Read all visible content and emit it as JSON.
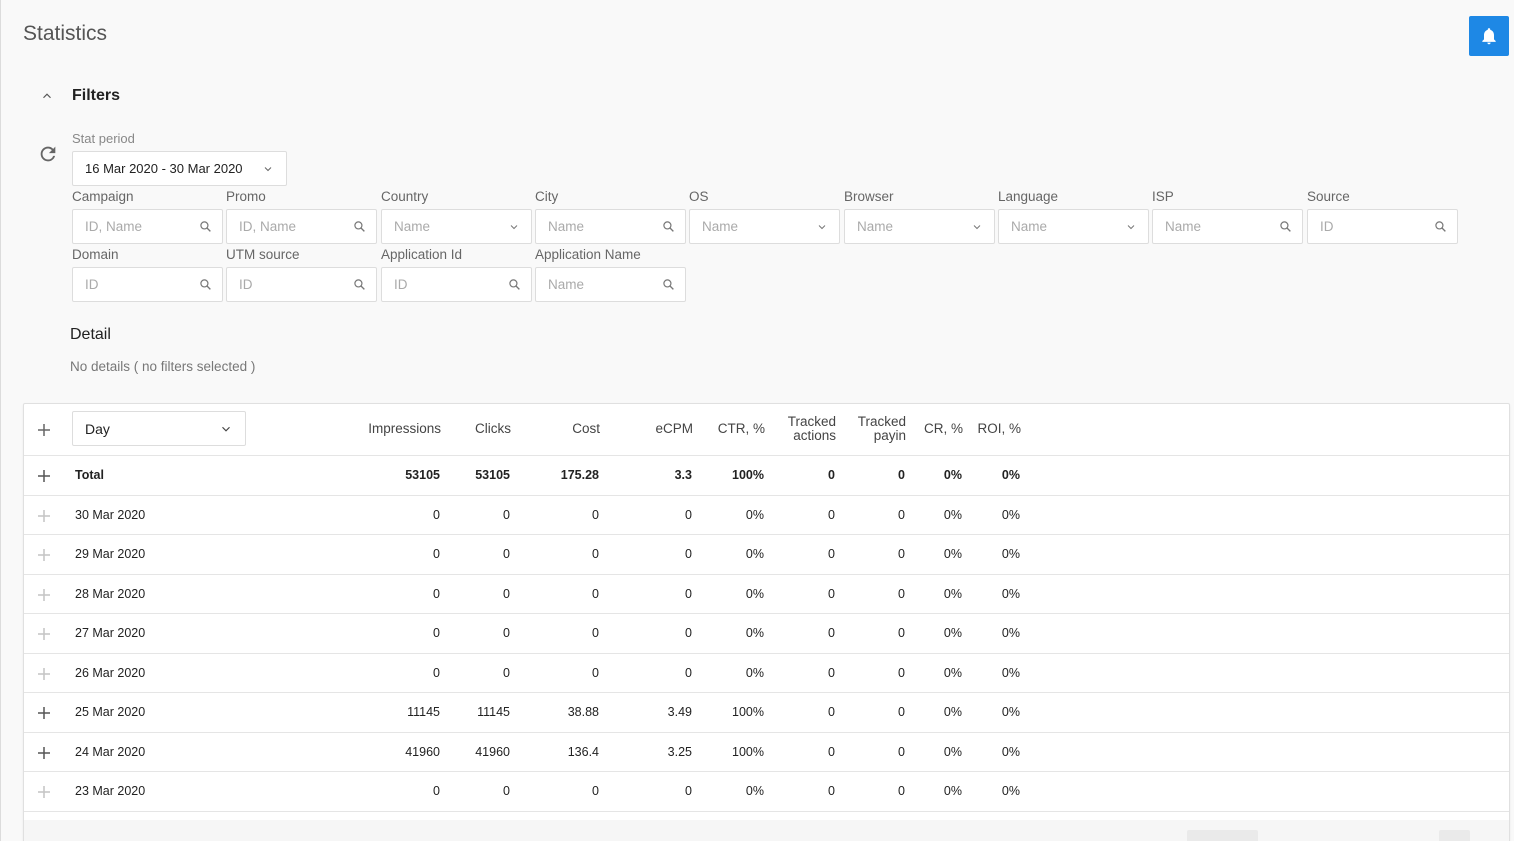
{
  "page": {
    "title": "Statistics"
  },
  "filters": {
    "title": "Filters",
    "stat_period_label": "Stat period",
    "stat_period_value": "16 Mar 2020 - 30 Mar 2020",
    "fields": [
      {
        "label": "Campaign",
        "placeholder": "ID, Name",
        "kind": "search"
      },
      {
        "label": "Promo",
        "placeholder": "ID, Name",
        "kind": "search"
      },
      {
        "label": "Country",
        "placeholder": "Name",
        "kind": "select"
      },
      {
        "label": "City",
        "placeholder": "Name",
        "kind": "search"
      },
      {
        "label": "OS",
        "placeholder": "Name",
        "kind": "select"
      },
      {
        "label": "Browser",
        "placeholder": "Name",
        "kind": "select"
      },
      {
        "label": "Language",
        "placeholder": "Name",
        "kind": "select"
      },
      {
        "label": "ISP",
        "placeholder": "Name",
        "kind": "search"
      },
      {
        "label": "Source",
        "placeholder": "ID",
        "kind": "search"
      },
      {
        "label": "Domain",
        "placeholder": "ID",
        "kind": "search"
      },
      {
        "label": "UTM source",
        "placeholder": "ID",
        "kind": "search"
      },
      {
        "label": "Application Id",
        "placeholder": "ID",
        "kind": "search"
      },
      {
        "label": "Application Name",
        "placeholder": "Name",
        "kind": "search"
      }
    ]
  },
  "detail": {
    "title": "Detail",
    "subtitle": "No details ( no filters selected )"
  },
  "table": {
    "group_by": "Day",
    "columns": [
      "Impressions",
      "Clicks",
      "Cost",
      "eCPM",
      "CTR, %",
      "Tracked actions",
      "Tracked payin",
      "CR, %",
      "ROI, %"
    ],
    "total": {
      "label": "Total",
      "values": [
        "53105",
        "53105",
        "175.28",
        "3.3",
        "100%",
        "0",
        "0",
        "0%",
        "0%"
      ]
    },
    "rows": [
      {
        "date": "30 Mar 2020",
        "values": [
          "0",
          "0",
          "0",
          "0",
          "0%",
          "0",
          "0",
          "0%",
          "0%"
        ],
        "expandable": false
      },
      {
        "date": "29 Mar 2020",
        "values": [
          "0",
          "0",
          "0",
          "0",
          "0%",
          "0",
          "0",
          "0%",
          "0%"
        ],
        "expandable": false
      },
      {
        "date": "28 Mar 2020",
        "values": [
          "0",
          "0",
          "0",
          "0",
          "0%",
          "0",
          "0",
          "0%",
          "0%"
        ],
        "expandable": false
      },
      {
        "date": "27 Mar 2020",
        "values": [
          "0",
          "0",
          "0",
          "0",
          "0%",
          "0",
          "0",
          "0%",
          "0%"
        ],
        "expandable": false
      },
      {
        "date": "26 Mar 2020",
        "values": [
          "0",
          "0",
          "0",
          "0",
          "0%",
          "0",
          "0",
          "0%",
          "0%"
        ],
        "expandable": false
      },
      {
        "date": "25 Mar 2020",
        "values": [
          "11145",
          "11145",
          "38.88",
          "3.49",
          "100%",
          "0",
          "0",
          "0%",
          "0%"
        ],
        "expandable": true
      },
      {
        "date": "24 Mar 2020",
        "values": [
          "41960",
          "41960",
          "136.4",
          "3.25",
          "100%",
          "0",
          "0",
          "0%",
          "0%"
        ],
        "expandable": true
      },
      {
        "date": "23 Mar 2020",
        "values": [
          "0",
          "0",
          "0",
          "0",
          "0%",
          "0",
          "0",
          "0%",
          "0%"
        ],
        "expandable": false
      }
    ]
  },
  "colors": {
    "accent": "#1e88e5",
    "background": "#f9f9f9"
  },
  "icons": {
    "notifications": "bell-icon",
    "collapse": "chevron-up-icon",
    "refresh": "refresh-icon",
    "search": "search-icon",
    "dropdown": "chevron-down-icon",
    "expand": "plus-icon"
  }
}
